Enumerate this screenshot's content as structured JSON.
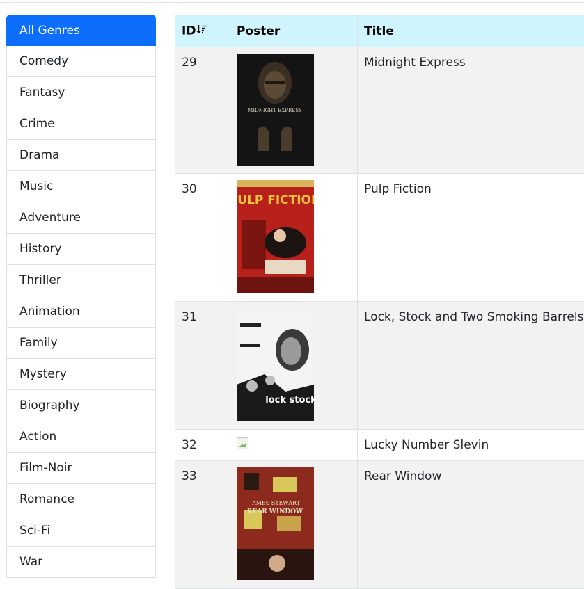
{
  "sidebar": {
    "genres": [
      {
        "label": "All Genres",
        "active": true
      },
      {
        "label": "Comedy"
      },
      {
        "label": "Fantasy"
      },
      {
        "label": "Crime"
      },
      {
        "label": "Drama"
      },
      {
        "label": "Music"
      },
      {
        "label": "Adventure"
      },
      {
        "label": "History"
      },
      {
        "label": "Thriller"
      },
      {
        "label": "Animation"
      },
      {
        "label": "Family"
      },
      {
        "label": "Mystery"
      },
      {
        "label": "Biography"
      },
      {
        "label": "Action"
      },
      {
        "label": "Film-Noir"
      },
      {
        "label": "Romance"
      },
      {
        "label": "Sci-Fi"
      },
      {
        "label": "War"
      }
    ]
  },
  "table": {
    "headers": {
      "id": "ID",
      "poster": "Poster",
      "title": "Title"
    },
    "sort_icon": "sort-descending-icon",
    "rows": [
      {
        "id": "29",
        "title": "Midnight Express",
        "poster": "midnight-express-poster"
      },
      {
        "id": "30",
        "title": "Pulp Fiction",
        "poster": "pulp-fiction-poster"
      },
      {
        "id": "31",
        "title": "Lock, Stock and Two Smoking Barrels",
        "poster": "lock-stock-poster"
      },
      {
        "id": "32",
        "title": "Lucky Number Slevin",
        "poster": "broken-image-icon"
      },
      {
        "id": "33",
        "title": "Rear Window",
        "poster": "rear-window-poster"
      }
    ]
  },
  "colors": {
    "active": "#0d6efd",
    "header": "#cff4fc",
    "stripe": "#f2f2f2",
    "border": "#dee2e6"
  },
  "poster_text": {
    "midnight_express": "MIDNIGHT EXPRESS",
    "pulp_fiction": "PULP FICTION",
    "lock_stock": "lock stock",
    "rear_window_1": "JAMES STEWART",
    "rear_window_2": "REAR WINDOW"
  }
}
